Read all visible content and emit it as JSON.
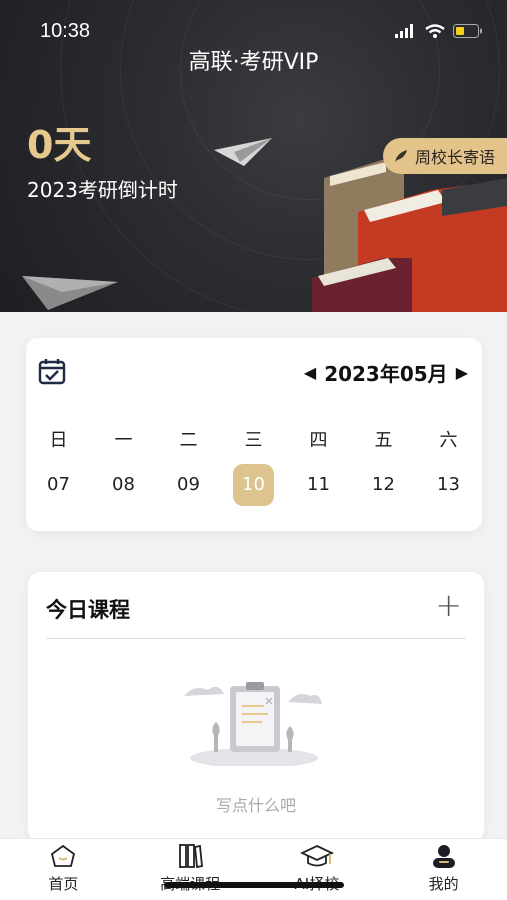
{
  "status": {
    "time": "10:38"
  },
  "header": {
    "title": "高联·考研VIP",
    "days": "0天",
    "countdown_label": "2023考研倒计时",
    "president_label": "周校长寄语"
  },
  "calendar": {
    "month_label": "2023年05月",
    "weekdays": [
      "日",
      "一",
      "二",
      "三",
      "四",
      "五",
      "六"
    ],
    "dates": [
      "07",
      "08",
      "09",
      "10",
      "11",
      "12",
      "13"
    ],
    "selected": "10",
    "accent": "#ddc38d"
  },
  "course": {
    "title": "今日课程",
    "empty_text": "写点什么吧"
  },
  "tabbar": {
    "items": [
      {
        "label": "首页",
        "icon": "home-icon"
      },
      {
        "label": "高端课程",
        "icon": "books-icon"
      },
      {
        "label": "AI择校",
        "icon": "graduation-cap-icon"
      },
      {
        "label": "我的",
        "icon": "profile-icon"
      }
    ]
  },
  "colors": {
    "gold": "#e2c48b",
    "hero_dark": "#2a2c30"
  }
}
